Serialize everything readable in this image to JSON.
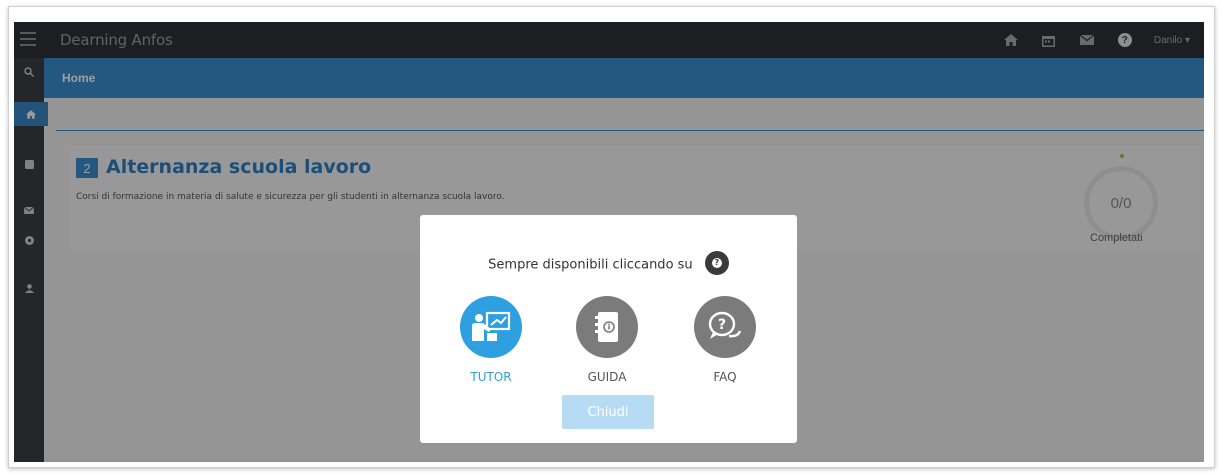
{
  "app": {
    "brand": "Dearning Anfos"
  },
  "navbar": {
    "icons": [
      "home-icon",
      "calendar-icon",
      "mail-icon",
      "help-icon"
    ],
    "help_symbol": "?",
    "user": "Danilo ▾"
  },
  "header": {
    "title": "Home"
  },
  "course": {
    "number": "2",
    "title": "Alternanza scuola lavoro",
    "description": "Corsi di formazione in materia di salute e sicurezza per gli studenti in alternanza scuola lavoro.",
    "progress": "0/0",
    "progress_label": "Completati"
  },
  "modal": {
    "hint": "Sempre disponibili cliccando su",
    "options": [
      {
        "label": "TUTOR",
        "icon": "tutor-icon",
        "color": "#2e9fe0"
      },
      {
        "label": "GUIDA",
        "icon": "guide-icon",
        "color": "#7b7b7b"
      },
      {
        "label": "FAQ",
        "icon": "faq-icon",
        "color": "#7b7b7b"
      }
    ],
    "close_label": "Chiudi"
  },
  "colors": {
    "accent": "#3a8fd0",
    "navbar": "#2e3136",
    "close_button": "#b6dcf5"
  }
}
